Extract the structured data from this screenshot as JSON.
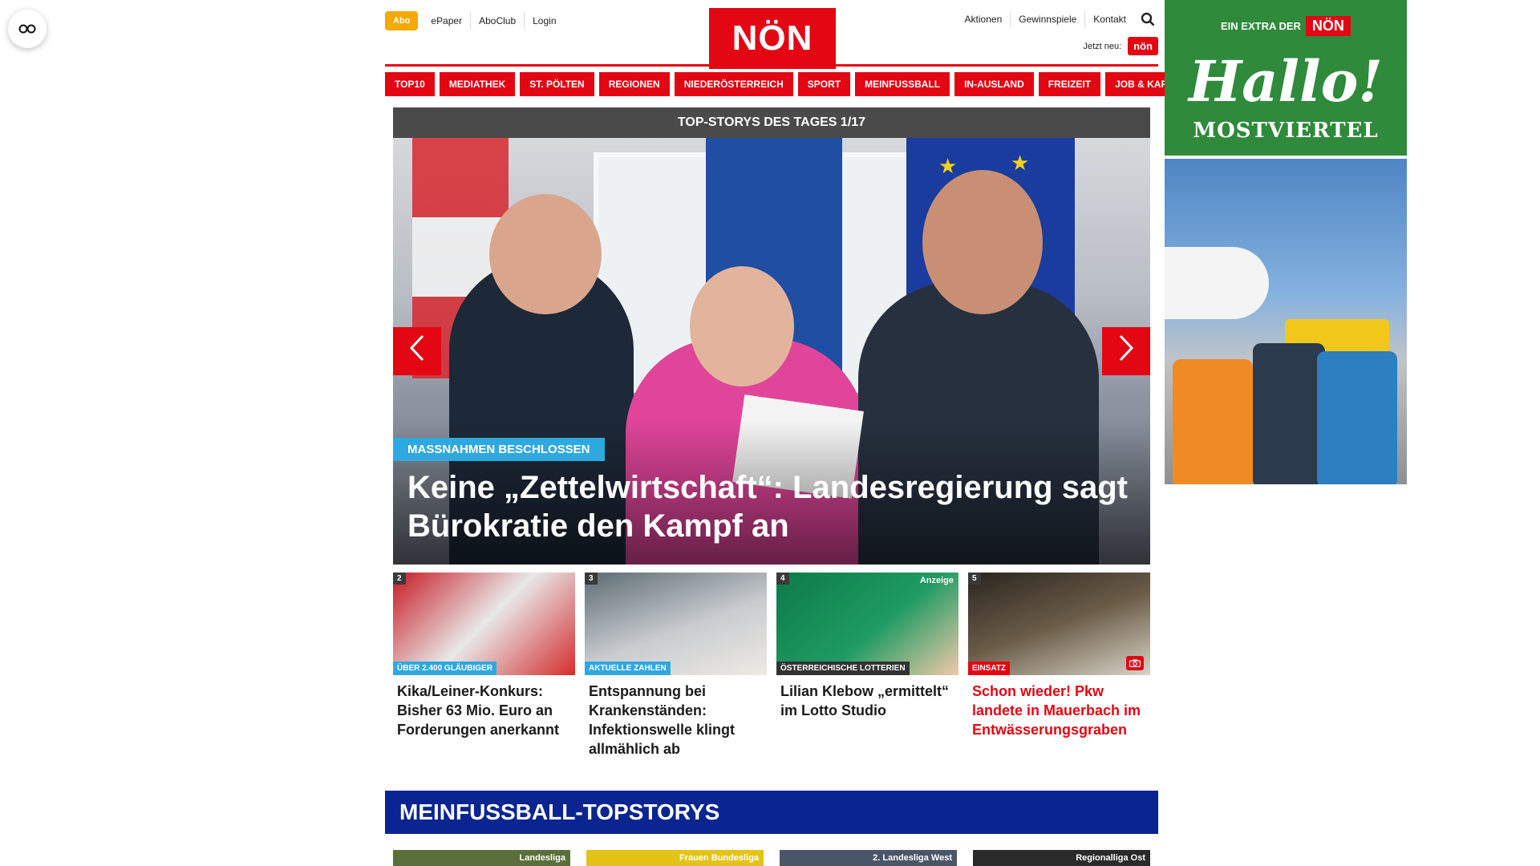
{
  "reader_button": {
    "icon": "glasses-icon"
  },
  "header": {
    "abo_label": "Abo",
    "utility_left": [
      "ePaper",
      "AboClub",
      "Login"
    ],
    "logo_text": "NÖN",
    "utility_right": [
      "Aktionen",
      "Gewinnspiele",
      "Kontakt"
    ],
    "search_icon": "search-icon",
    "jetzt_label": "Jetzt neu:",
    "jetzt_badge": "nön"
  },
  "nav": [
    "TOP10",
    "MEDIATHEK",
    "ST. PÖLTEN",
    "REGIONEN",
    "NIEDERÖSTERREICH",
    "SPORT",
    "MEINFUSSBALL",
    "IN-AUSLAND",
    "FREIZEIT",
    "JOB & KARRIERE"
  ],
  "top_stories": {
    "bar_title": "TOP-STORYS DES TAGES 1/17",
    "hero_tag": "MASSNAHMEN BESCHLOSSEN",
    "hero_title": "Keine „Zettelwirtschaft“: Landesregierung sagt Bürokratie den Kampf an",
    "prev_icon": "chevron-left-icon",
    "next_icon": "chevron-right-icon"
  },
  "stories": [
    {
      "num": "2",
      "tag": "ÜBER 2.400 GLÄUBIGER",
      "title": "Kika/Leiner-Konkurs: Bisher 63 Mio. Euro an Forderungen anerkannt",
      "anzeige": ""
    },
    {
      "num": "3",
      "tag": "AKTUELLE ZAHLEN",
      "title": "Entspannung bei Krankenständen: Infektionswelle klingt allmählich ab",
      "anzeige": ""
    },
    {
      "num": "4",
      "tag": "ÖSTERREICHISCHE LOTTERIEN",
      "title": "Lilian Klebow „ermittelt“ im Lotto Studio",
      "anzeige": "Anzeige"
    },
    {
      "num": "5",
      "tag": "EINSATZ",
      "title": "Schon wieder! Pkw landete in Mauerbach im Entwässerungsgraben",
      "anzeige": ""
    }
  ],
  "section": {
    "title": "MEINFUSSBALL-TOPSTORYS",
    "labels": [
      "Landesliga",
      "Frauen Bundesliga",
      "2. Landesliga West",
      "Regionalliga Ost"
    ]
  },
  "ad": {
    "extra_label": "EIN EXTRA DER",
    "extra_badge": "NÖN",
    "hallo": "Hallo!",
    "region": "MOSTVIERTEL"
  }
}
